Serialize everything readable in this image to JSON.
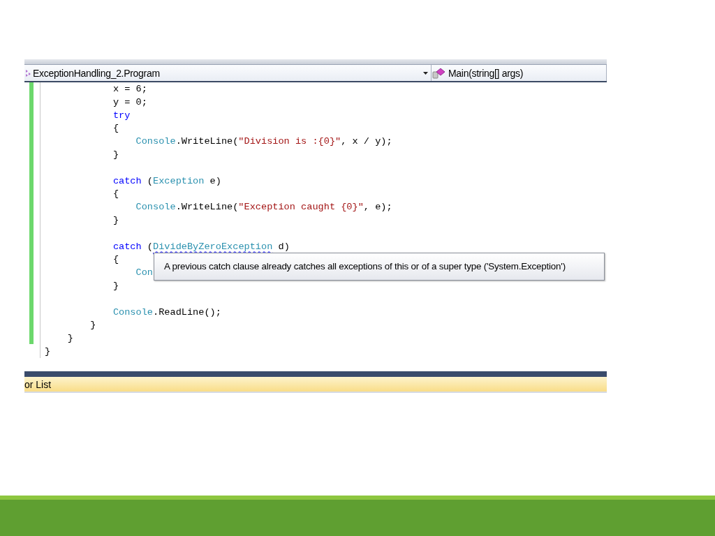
{
  "editor": {
    "type_selector": {
      "label": "ExceptionHandling_2.Program"
    },
    "member_selector": {
      "label": "Main(string[] args)"
    },
    "lines": [
      {
        "kind": "code",
        "tokens": [
          {
            "kind": "plain",
            "text": "            x = 6;"
          }
        ]
      },
      {
        "kind": "code",
        "tokens": [
          {
            "kind": "plain",
            "text": "            y = 0;"
          }
        ]
      },
      {
        "kind": "code",
        "tokens": [
          {
            "kind": "keyword",
            "text": "            try"
          }
        ]
      },
      {
        "kind": "code",
        "tokens": [
          {
            "kind": "plain",
            "text": "            {"
          }
        ]
      },
      {
        "kind": "code",
        "tokens": [
          {
            "kind": "type",
            "text": "                Console"
          },
          {
            "kind": "plain",
            "text": ".WriteLine("
          },
          {
            "kind": "string",
            "text": "\"Division is :{0}\""
          },
          {
            "kind": "plain",
            "text": ", x / y);"
          }
        ]
      },
      {
        "kind": "code",
        "tokens": [
          {
            "kind": "plain",
            "text": "            }"
          }
        ]
      },
      {
        "kind": "blank"
      },
      {
        "kind": "code",
        "tokens": [
          {
            "kind": "keyword",
            "text": "            catch"
          },
          {
            "kind": "plain",
            "text": " ("
          },
          {
            "kind": "type",
            "text": "Exception"
          },
          {
            "kind": "plain",
            "text": " e)"
          }
        ]
      },
      {
        "kind": "code",
        "tokens": [
          {
            "kind": "plain",
            "text": "            {"
          }
        ]
      },
      {
        "kind": "code",
        "tokens": [
          {
            "kind": "type",
            "text": "                Console"
          },
          {
            "kind": "plain",
            "text": ".WriteLine("
          },
          {
            "kind": "string",
            "text": "\"Exception caught {0}\""
          },
          {
            "kind": "plain",
            "text": ", e);"
          }
        ]
      },
      {
        "kind": "code",
        "tokens": [
          {
            "kind": "plain",
            "text": "            }"
          }
        ]
      },
      {
        "kind": "blank"
      },
      {
        "kind": "code",
        "tokens": [
          {
            "kind": "keyword",
            "text": "            catch"
          },
          {
            "kind": "plain",
            "text": " ("
          },
          {
            "kind": "error",
            "text": "DivideByZeroException"
          },
          {
            "kind": "plain",
            "text": " d)"
          }
        ]
      },
      {
        "kind": "code",
        "tokens": [
          {
            "kind": "plain",
            "text": "            {"
          }
        ]
      },
      {
        "kind": "code",
        "tokens": [
          {
            "kind": "type",
            "text": "                Con"
          }
        ]
      },
      {
        "kind": "code",
        "tokens": [
          {
            "kind": "plain",
            "text": "            }"
          }
        ]
      },
      {
        "kind": "blank"
      },
      {
        "kind": "code",
        "tokens": [
          {
            "kind": "type",
            "text": "            Console"
          },
          {
            "kind": "plain",
            "text": ".ReadLine();"
          }
        ]
      },
      {
        "kind": "code",
        "tokens": [
          {
            "kind": "plain",
            "text": "        }"
          }
        ]
      },
      {
        "kind": "code",
        "tokens": [
          {
            "kind": "plain",
            "text": "    }"
          }
        ]
      },
      {
        "kind": "code",
        "tokens": [
          {
            "kind": "plain",
            "text": "}"
          }
        ]
      }
    ],
    "tooltip": {
      "text": "A previous catch clause already catches all exceptions of this or of a super type ('System.Exception')"
    },
    "panel_tab": {
      "label": "or List"
    }
  }
}
